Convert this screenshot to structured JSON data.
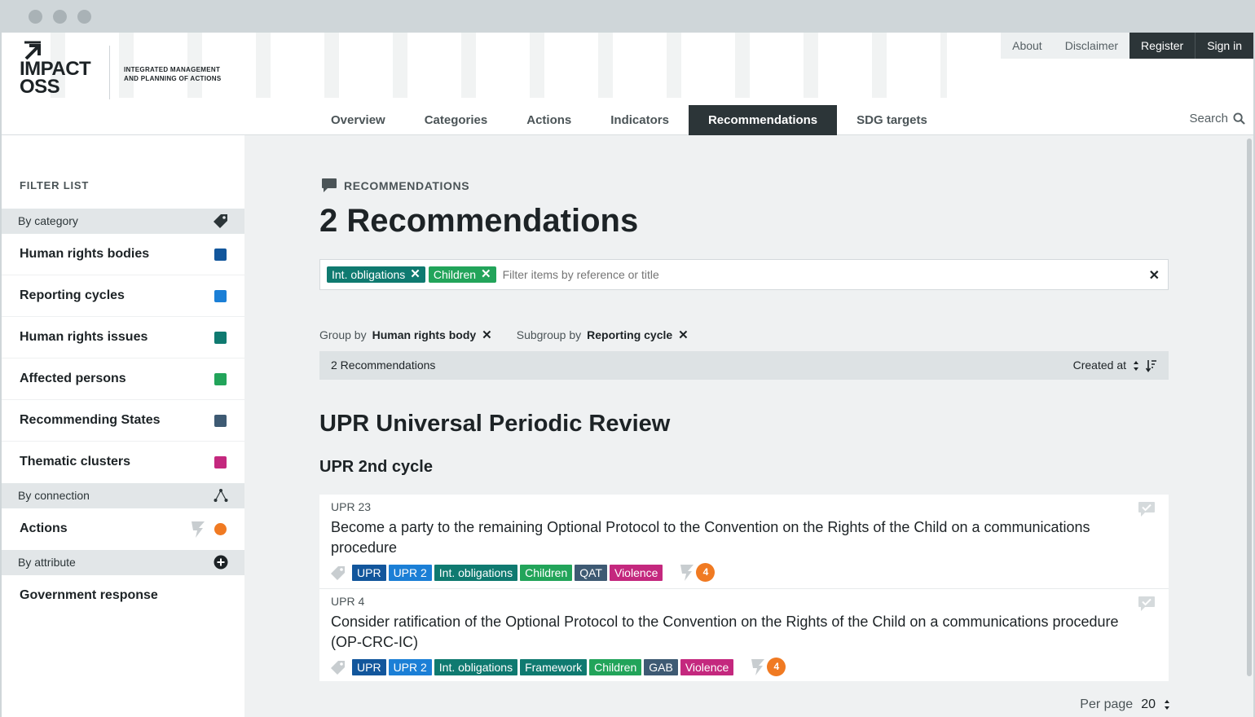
{
  "window_controls": [
    "close",
    "minimize",
    "maximize"
  ],
  "logo": {
    "line1": "IMPACT",
    "line2": "OSS",
    "tagline1": "INTEGRATED MANAGEMENT",
    "tagline2": "AND PLANNING OF ACTIONS"
  },
  "topnav": {
    "about": "About",
    "disclaimer": "Disclaimer",
    "register": "Register",
    "signin": "Sign in"
  },
  "mainnav": [
    "Overview",
    "Categories",
    "Actions",
    "Indicators",
    "Recommendations",
    "SDG targets"
  ],
  "mainnav_active": "Recommendations",
  "search_label": "Search",
  "sidebar": {
    "title": "FILTER LIST",
    "by_category": "By category",
    "categories": [
      {
        "label": "Human rights bodies",
        "color": "#12569c"
      },
      {
        "label": "Reporting cycles",
        "color": "#1b7fd6"
      },
      {
        "label": "Human rights issues",
        "color": "#0f7a70"
      },
      {
        "label": "Affected persons",
        "color": "#22a45a"
      },
      {
        "label": "Recommending States",
        "color": "#3e5a73"
      },
      {
        "label": "Thematic clusters",
        "color": "#c4287e"
      }
    ],
    "by_connection": "By connection",
    "connections": [
      {
        "label": "Actions",
        "color": "#f07a22"
      }
    ],
    "by_attribute": "By attribute",
    "attributes": [
      {
        "label": "Government response"
      }
    ]
  },
  "main": {
    "eyebrow": "RECOMMENDATIONS",
    "title": "2 Recommendations",
    "active_filters": [
      {
        "label": "Int. obligations",
        "color": "#0f7a70"
      },
      {
        "label": "Children",
        "color": "#22a45a"
      }
    ],
    "filter_placeholder": "Filter items by reference or title",
    "group_by_label": "Group by",
    "group_by_value": "Human rights body",
    "subgroup_by_label": "Subgroup by",
    "subgroup_by_value": "Reporting cycle",
    "list_count": "2 Recommendations",
    "sort_label": "Created at",
    "group_title": "UPR Universal Periodic Review",
    "subgroup_title": "UPR 2nd cycle",
    "per_page_label": "Per page",
    "per_page_value": "20"
  },
  "recommendations": [
    {
      "ref": "UPR 23",
      "title": "Become a party to the remaining Optional Protocol to the Convention on the Rights of the Child on a communications procedure",
      "tags": [
        {
          "label": "UPR",
          "color": "#12569c"
        },
        {
          "label": "UPR 2",
          "color": "#1b7fd6"
        },
        {
          "label": "Int. obligations",
          "color": "#0f7a70"
        },
        {
          "label": "Children",
          "color": "#22a45a"
        },
        {
          "label": "QAT",
          "color": "#3e5a73"
        },
        {
          "label": "Violence",
          "color": "#c4287e"
        }
      ],
      "actions_count": "4"
    },
    {
      "ref": "UPR 4",
      "title": "Consider ratification of the Optional Protocol to the Convention on the Rights of the Child on a communications procedure (OP-CRC-IC)",
      "tags": [
        {
          "label": "UPR",
          "color": "#12569c"
        },
        {
          "label": "UPR 2",
          "color": "#1b7fd6"
        },
        {
          "label": "Int. obligations",
          "color": "#0f7a70"
        },
        {
          "label": "Framework",
          "color": "#0f7a70"
        },
        {
          "label": "Children",
          "color": "#22a45a"
        },
        {
          "label": "GAB",
          "color": "#3e5a73"
        },
        {
          "label": "Violence",
          "color": "#c4287e"
        }
      ],
      "actions_count": "4"
    }
  ]
}
